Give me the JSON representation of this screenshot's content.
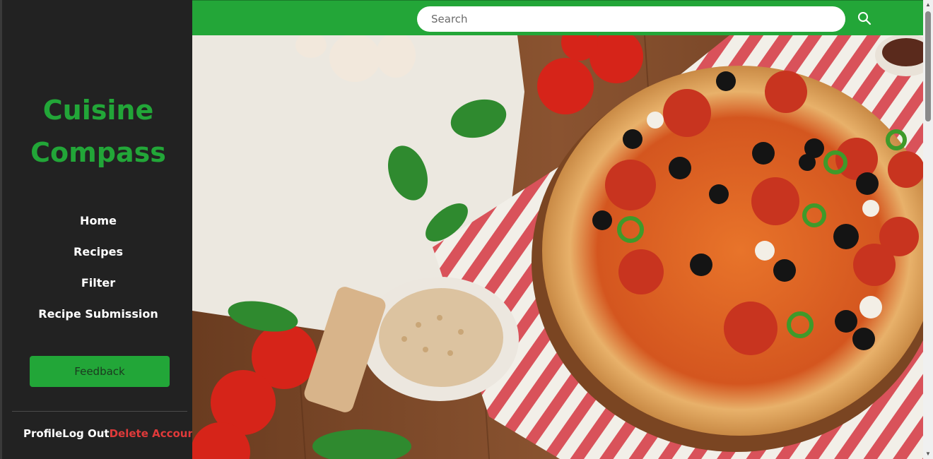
{
  "brand": {
    "line1": "Cuisine",
    "line2": "Compass"
  },
  "nav": [
    {
      "label": "Home"
    },
    {
      "label": "Recipes"
    },
    {
      "label": "Filter"
    },
    {
      "label": "Recipe Submission"
    }
  ],
  "feedback_label": "Feedback",
  "footer": {
    "profile": "Profile",
    "logout": "Log Out",
    "delete": "Delete Account"
  },
  "search": {
    "placeholder": "Search"
  },
  "icons": {
    "search": "search-icon"
  },
  "colors": {
    "accent": "#22a638",
    "sidebar": "#222222",
    "danger": "#e03a3a"
  }
}
